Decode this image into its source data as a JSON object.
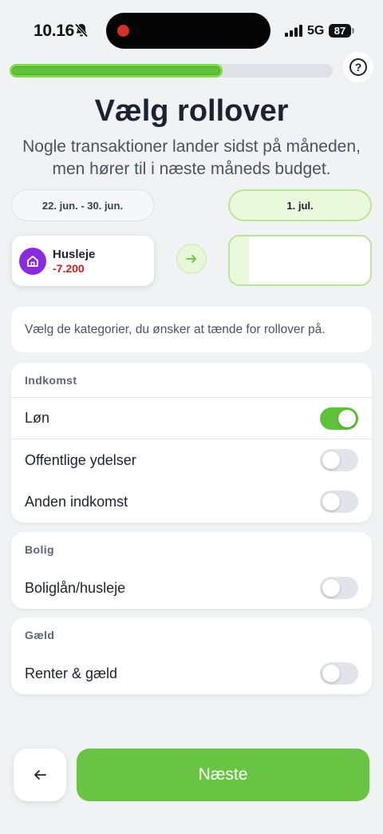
{
  "status_bar": {
    "time": "10.16",
    "network": "5G",
    "battery": "87",
    "icons": [
      "bell-slash-icon",
      "signal-icon"
    ]
  },
  "progress": {
    "fraction": 0.66
  },
  "help": {
    "icon": "question-circle-icon"
  },
  "header": {
    "title": "Vælg rollover",
    "subtitle_line1": "Nogle transaktioner lander sidst på måneden,",
    "subtitle_line2": "men hører til i næste måneds budget."
  },
  "dates": {
    "from": "22. jun. - 30. jun.",
    "to": "1. jul."
  },
  "transaction": {
    "icon": "home-icon",
    "name": "Husleje",
    "amount": "-7.200",
    "icon_color": "#8a2be2",
    "amount_color": "#d11f1f"
  },
  "info_text": "Vælg de kategorier, du ønsker at tænde for rollover på.",
  "categories": [
    {
      "title": "Indkomst",
      "items": [
        {
          "label": "Løn",
          "enabled": true
        },
        {
          "label": "Offentlige ydelser",
          "enabled": false
        },
        {
          "label": "Anden indkomst",
          "enabled": false
        }
      ]
    },
    {
      "title": "Bolig",
      "items": [
        {
          "label": "Boliglån/husleje",
          "enabled": false
        }
      ]
    },
    {
      "title": "Gæld",
      "items": [
        {
          "label": "Renter & gæld",
          "enabled": false
        }
      ]
    }
  ],
  "buttons": {
    "back_icon": "arrow-left-icon",
    "next_label": "Næste"
  },
  "colors": {
    "accent": "#6ac443",
    "toggle_on": "#5fc23a",
    "toggle_off": "#e2e4eb",
    "background": "#f1f2f4"
  }
}
